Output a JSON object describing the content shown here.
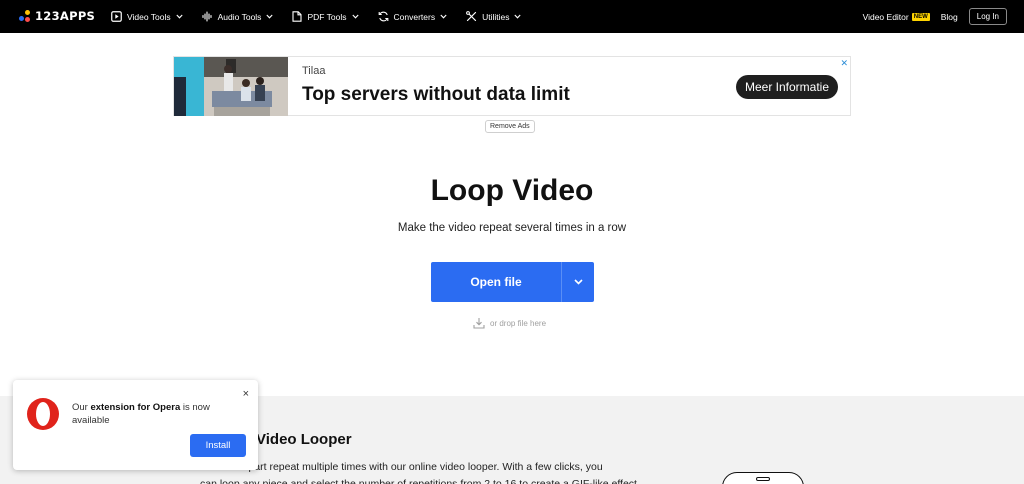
{
  "header": {
    "logo_text": "123APPS",
    "nav": [
      {
        "label": "Video Tools",
        "icon": "play-square-icon"
      },
      {
        "label": "Audio Tools",
        "icon": "waveform-icon"
      },
      {
        "label": "PDF Tools",
        "icon": "document-icon"
      },
      {
        "label": "Converters",
        "icon": "refresh-icon"
      },
      {
        "label": "Utilities",
        "icon": "tools-icon"
      }
    ],
    "video_editor": "Video Editor",
    "new_badge": "NEW",
    "blog": "Blog",
    "login": "Log In"
  },
  "ad": {
    "brand": "Tilaa",
    "headline": "Top servers without data limit",
    "cta": "Meer Informatie",
    "close": "✕",
    "remove_ads": "Remove Ads"
  },
  "hero": {
    "title": "Loop Video",
    "subtitle": "Make the video repeat several times in a row",
    "open_file": "Open file",
    "drop_text": "or drop file here"
  },
  "section": {
    "title": "Video Looper",
    "text_line1": "ideo or its part repeat multiple times with our online video looper. With a few clicks, you",
    "text_line2": "can loop any piece and select the number of repetitions from 2 to 16 to create a GIF-like effect."
  },
  "popup": {
    "text_before": "Our ",
    "text_bold": "extension for Opera",
    "text_after": " is now available",
    "close": "×",
    "install": "Install"
  },
  "colors": {
    "accent": "#2b6cf2",
    "badge": "#ffd400",
    "opera": "#e0231b"
  }
}
